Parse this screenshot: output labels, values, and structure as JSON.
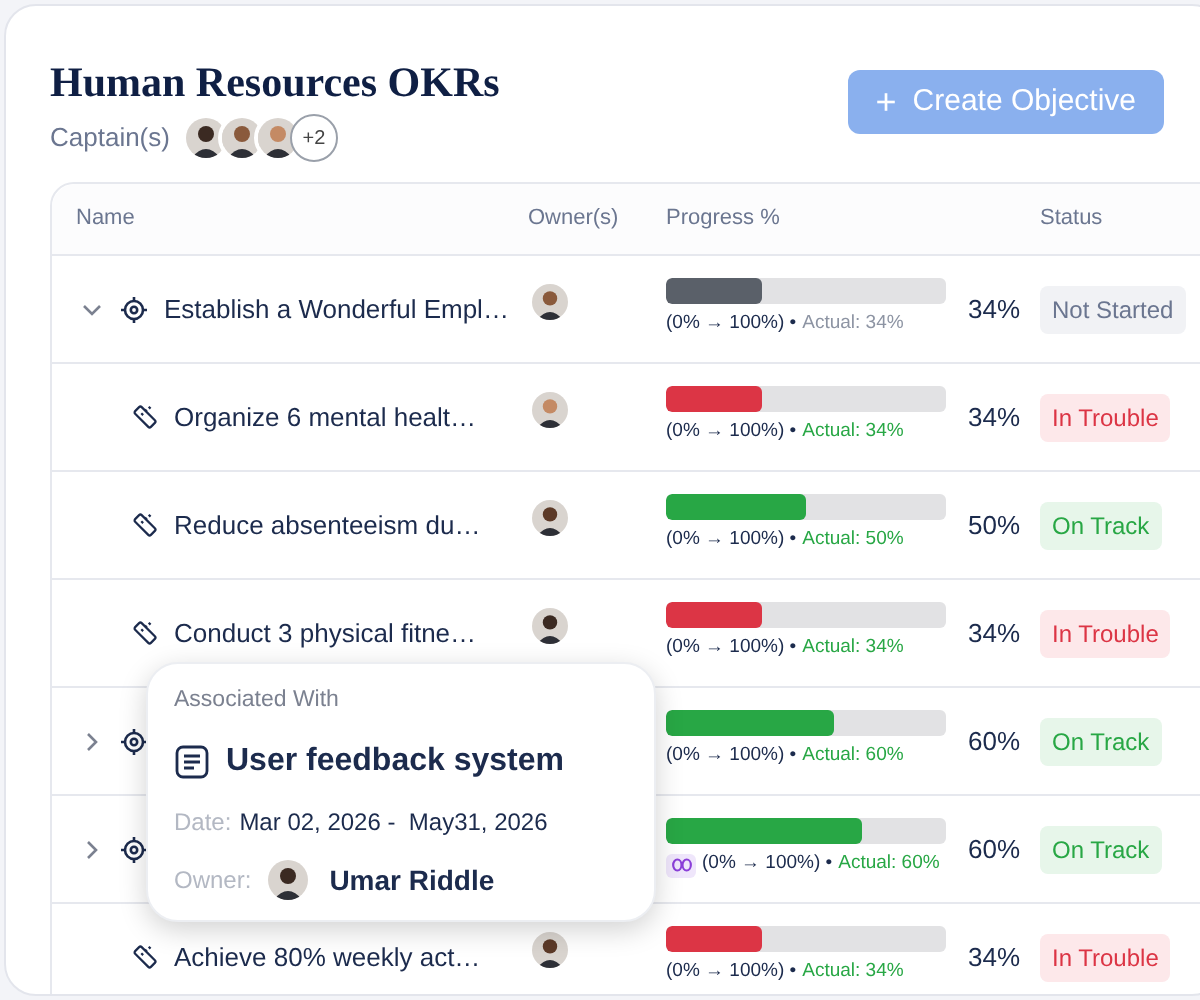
{
  "title": "Human Resources OKRs",
  "captains": {
    "label": "Captain(s)",
    "avatars": [
      {
        "kind": "photo"
      },
      {
        "kind": "photo"
      },
      {
        "kind": "photo"
      }
    ],
    "more": "+2"
  },
  "create_button": {
    "icon": "+",
    "label": "Create Objective"
  },
  "table": {
    "columns": [
      "Name",
      "Owner(s)",
      "Progress %",
      "Status"
    ],
    "rows": [
      {
        "kind": "objective",
        "expanded": true,
        "name": "Establish a Wonderful Empl…",
        "owner": true,
        "level": 0.34,
        "range": "(0% → 100%) •",
        "actual": "Actual: 34%",
        "percent": "34%",
        "status": {
          "label": "Not Started",
          "kind": "neutral"
        }
      },
      {
        "kind": "key_result",
        "name": "Organize 6 mental healt…",
        "owner": true,
        "level": 0.34,
        "range": "(0% → 100%) •",
        "actual": "Actual: 34%",
        "percent": "34%",
        "status": {
          "label": "In Trouble",
          "kind": "danger"
        }
      },
      {
        "kind": "key_result",
        "name": "Reduce absenteeism du…",
        "owner": true,
        "level": 0.5,
        "range": "(0% → 100%) •",
        "actual": "Actual: 50%",
        "percent": "50%",
        "status": {
          "label": "On Track",
          "kind": "success"
        }
      },
      {
        "kind": "key_result",
        "name": "Conduct 3 physical fitne…",
        "owner": true,
        "level": 0.34,
        "range": "(0% → 100%) •",
        "actual": "Actual: 34%",
        "percent": "34%",
        "status": {
          "label": "In Trouble",
          "kind": "danger"
        }
      },
      {
        "kind": "objective",
        "expanded": false,
        "level": 0.6,
        "range": "(0% → 100%) •",
        "actual": "Actual: 60%",
        "percent": "60%",
        "status": {
          "label": "On Track",
          "kind": "success"
        }
      },
      {
        "kind": "objective",
        "expanded": false,
        "linked": true,
        "level": 0.7,
        "range": "(0% → 100%) •",
        "actual": "Actual: 60%",
        "percent": "60%",
        "status": {
          "label": "On Track",
          "kind": "success"
        }
      },
      {
        "kind": "key_result",
        "name": "Achieve 80% weekly act…",
        "owner": true,
        "level": 0.34,
        "range": "(0% → 100%) •",
        "actual": "Actual: 34%",
        "percent": "34%",
        "status": {
          "label": "In Trouble",
          "kind": "danger"
        }
      }
    ]
  },
  "popover": {
    "heading": "Associated With",
    "title": "User feedback system",
    "date_label": "Date:",
    "date": "Mar 02, 2026 -  May31, 2026",
    "owner_label": "Owner:",
    "owner": "Umar Riddle"
  }
}
